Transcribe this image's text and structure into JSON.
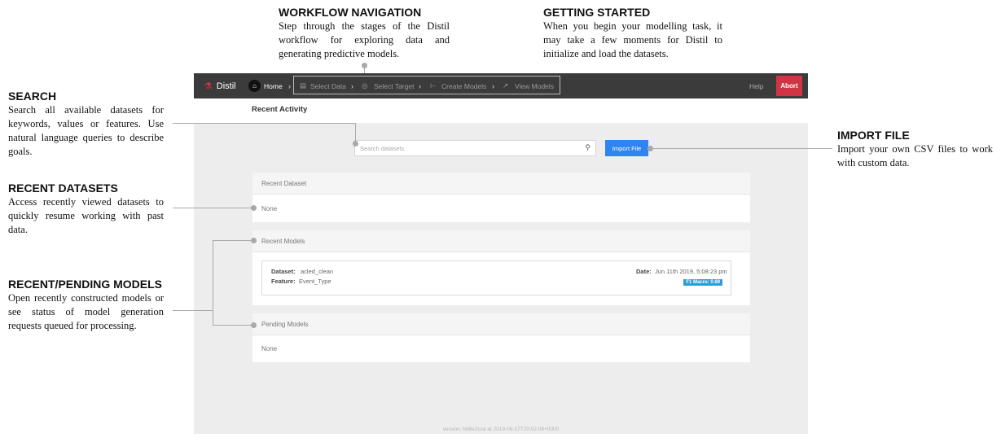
{
  "annotations": {
    "workflow": {
      "title": "WORKFLOW NAVIGATION",
      "text": "Step through the stages of the Distil workflow for exploring data and generating predictive models."
    },
    "getting_started": {
      "title": "GETTING STARTED",
      "text": "When you begin your modelling task, it may take a few moments for Distil to initialize and load the datasets."
    },
    "search": {
      "title": "SEARCH",
      "text": "Search all available datasets for keywords, values or features. Use natural language queries to describe goals."
    },
    "recent_datasets": {
      "title": "RECENT DATASETS",
      "text": "Access recently viewed datasets to quickly resume working with past data."
    },
    "recent_models": {
      "title": "RECENT/PENDING MODELS",
      "text": "Open recently constructed models or see status of model generation requests queued for processing."
    },
    "import_file": {
      "title": "IMPORT FILE",
      "text": "Import your own CSV files to work with custom data."
    }
  },
  "navbar": {
    "brand": "Distil",
    "brand_icon": "distil-logo-icon",
    "home": "Home",
    "steps": [
      {
        "label": "Select Data",
        "icon": "document-icon"
      },
      {
        "label": "Select Target",
        "icon": "target-icon"
      },
      {
        "label": "Create Models",
        "icon": "model-icon"
      },
      {
        "label": "View Models",
        "icon": "chart-line-icon"
      }
    ],
    "help": "Help",
    "abort": "Abort"
  },
  "main": {
    "heading": "Recent Activity",
    "search_placeholder": "Search datasets",
    "import_button": "Import File",
    "recent_dataset": {
      "title": "Recent Dataset",
      "body": "None"
    },
    "recent_models": {
      "title": "Recent Models",
      "item": {
        "dataset_label": "Dataset:",
        "dataset_value": "acled_clean",
        "feature_label": "Feature:",
        "feature_value": "Event_Type",
        "date_label": "Date:",
        "date_value": "Jun 11th 2019, 5:08:23 pm",
        "score_badge": "F1 Macro: 0.69"
      }
    },
    "pending_models": {
      "title": "Pending Models",
      "body": "None"
    },
    "version": "version: b68e2cca at 2019-06-17T20:02:06+0000"
  },
  "colors": {
    "navbar": "#3b3b3b",
    "abort": "#d13545",
    "accent": "#2f84f2",
    "badge": "#2a9fd6"
  }
}
